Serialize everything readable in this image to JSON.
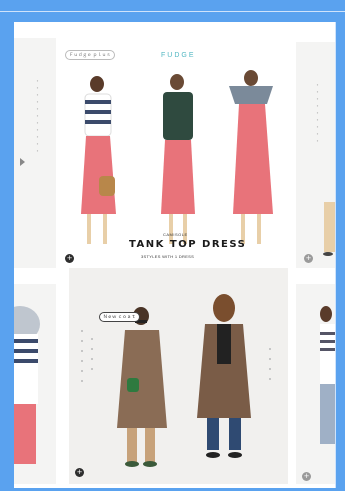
{
  "top_card": {
    "brand_chip": "Ｆｕｄｇｅ ｐｌｕｓ",
    "logo": "FUDGE",
    "subtitle": "CAMISOLE",
    "title": "TANK TOP DRESS",
    "caption": "3STYLES WITH 1 DRESS"
  },
  "bottom_card": {
    "speech_bubble": "Ｎｅｗ ｃｏａｔ"
  },
  "colors": {
    "frame": "#5aa2ef",
    "logo": "#52b7c2",
    "dress_pink": "#e8737a"
  }
}
